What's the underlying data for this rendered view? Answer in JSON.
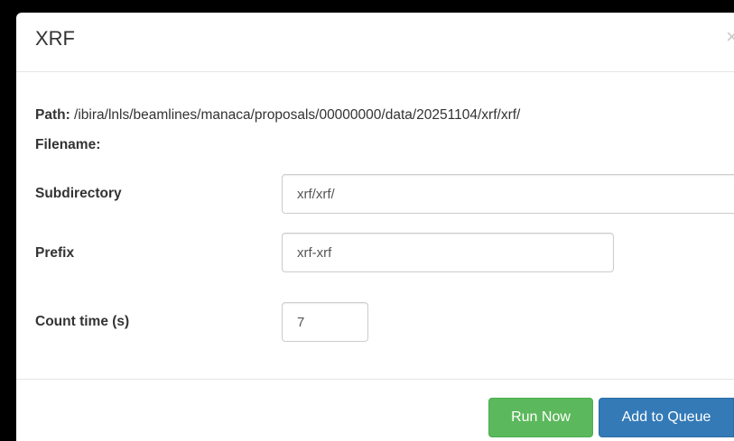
{
  "modal": {
    "title": "XRF",
    "close_symbol": "×"
  },
  "info": {
    "path_label": "Path:",
    "path_value": " /ibira/lnls/beamlines/manaca/proposals/00000000/data/20251104/xrf/xrf/",
    "filename_label": "Filename:"
  },
  "form": {
    "subdirectory_label": "Subdirectory",
    "subdirectory_value": "xrf/xrf/",
    "prefix_label": "Prefix",
    "prefix_value": "xrf-xrf",
    "count_time_label": "Count time (s)",
    "count_time_value": "7"
  },
  "footer": {
    "run_now_label": "Run Now",
    "add_to_queue_label": "Add to Queue"
  },
  "colors": {
    "success": "#5cb85c",
    "primary": "#337ab7"
  }
}
